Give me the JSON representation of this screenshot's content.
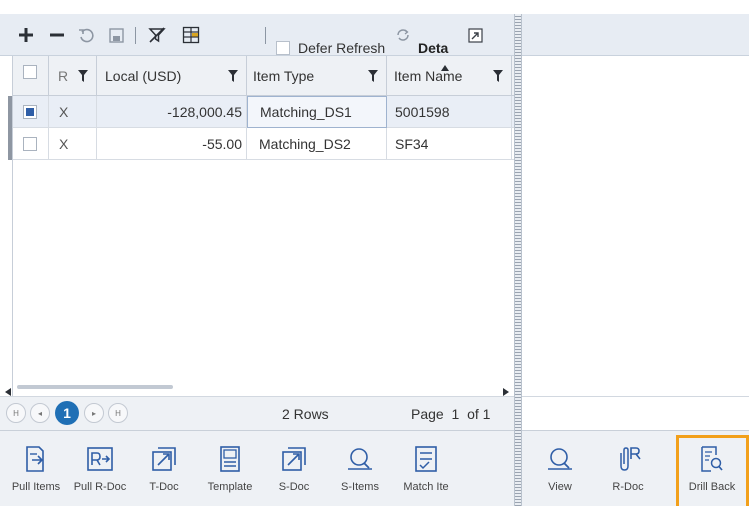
{
  "toolbar": {
    "defer_refresh_label": "Defer Refresh",
    "details_label": "Deta",
    "defer_refresh_checked": false
  },
  "grid": {
    "columns": [
      {
        "key": "select",
        "label": ""
      },
      {
        "key": "r",
        "label": "R"
      },
      {
        "key": "local_usd",
        "label": "Local (USD)"
      },
      {
        "key": "item_type",
        "label": "Item Type"
      },
      {
        "key": "item_name",
        "label": "Item Name",
        "sorted": "asc"
      }
    ],
    "rows": [
      {
        "selected": true,
        "r": "X",
        "local_usd": "-128,000.45",
        "item_type": "Matching_DS1",
        "item_name": "5001598"
      },
      {
        "selected": false,
        "r": "X",
        "local_usd": "-55.00",
        "item_type": "Matching_DS2",
        "item_name": "SF34"
      }
    ]
  },
  "pager": {
    "current_page": "1",
    "rows_count": "2 Rows",
    "page_label": "Page",
    "page_number": "1",
    "page_of": "of 1"
  },
  "actions_left": [
    {
      "label": "Pull Items",
      "icon": "pull-items-icon"
    },
    {
      "label": "Pull R-Doc",
      "icon": "pull-rdoc-icon"
    },
    {
      "label": "T-Doc",
      "icon": "tdoc-icon"
    },
    {
      "label": "Template",
      "icon": "template-icon"
    },
    {
      "label": "S-Doc",
      "icon": "sdoc-icon"
    },
    {
      "label": "S-Items",
      "icon": "sitems-icon"
    },
    {
      "label": "Match Ite",
      "icon": "match-items-icon"
    }
  ],
  "actions_right": [
    {
      "label": "View",
      "icon": "view-icon"
    },
    {
      "label": "R-Doc",
      "icon": "rdoc-icon"
    },
    {
      "label": "Drill Back",
      "icon": "drill-back-icon",
      "highlighted": true
    }
  ],
  "colors": {
    "accent": "#1f6fb5",
    "icon": "#2f5ea7",
    "highlight": "#f2a01b",
    "toolbar_bg": "#e7ecf3"
  }
}
